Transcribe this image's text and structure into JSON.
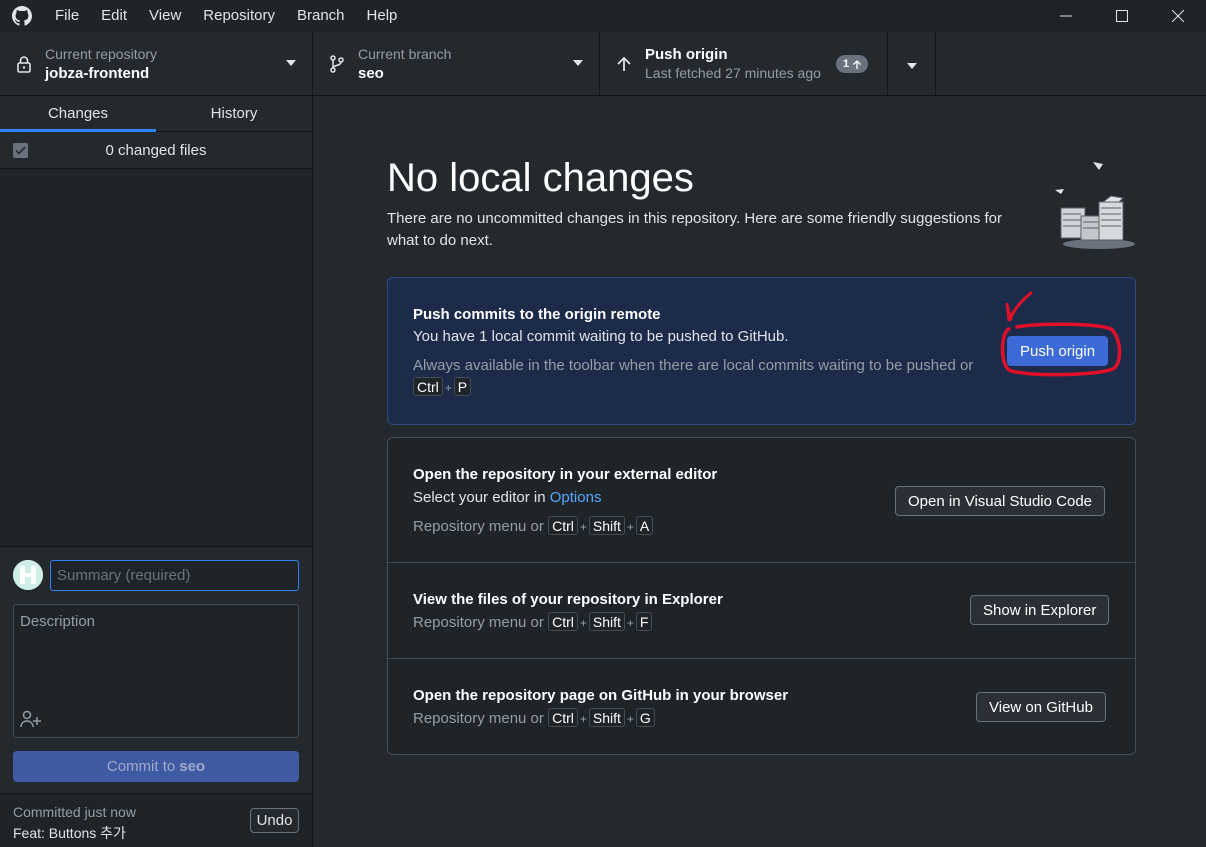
{
  "menubar": {
    "items": [
      "File",
      "Edit",
      "View",
      "Repository",
      "Branch",
      "Help"
    ]
  },
  "toolbar": {
    "repo": {
      "label": "Current repository",
      "value": "jobza-frontend"
    },
    "branch": {
      "label": "Current branch",
      "value": "seo"
    },
    "push": {
      "label": "Push origin",
      "sub": "Last fetched 27 minutes ago",
      "badge": "1"
    }
  },
  "sidebar": {
    "tabs": [
      "Changes",
      "History"
    ],
    "changes_count": "0 changed files",
    "commit": {
      "summary_placeholder": "Summary (required)",
      "description_placeholder": "Description",
      "button_prefix": "Commit to",
      "button_branch": "seo"
    },
    "last_commit": {
      "time": "Committed just now",
      "message": "Feat: Buttons 추가",
      "undo_label": "Undo"
    }
  },
  "main": {
    "title": "No local changes",
    "subtitle": "There are no uncommitted changes in this repository. Here are some friendly suggestions for what to do next.",
    "push_card": {
      "title": "Push commits to the origin remote",
      "desc": "You have 1 local commit waiting to be pushed to GitHub.",
      "hint_prefix": "Always available in the toolbar when there are local commits waiting to be pushed or",
      "keys": [
        "Ctrl",
        "P"
      ],
      "button": "Push origin"
    },
    "editor_row": {
      "title": "Open the repository in your external editor",
      "desc_prefix": "Select your editor in",
      "desc_link": "Options",
      "hint_prefix": "Repository menu or",
      "keys": [
        "Ctrl",
        "Shift",
        "A"
      ],
      "button": "Open in Visual Studio Code"
    },
    "explorer_row": {
      "title": "View the files of your repository in Explorer",
      "hint_prefix": "Repository menu or",
      "keys": [
        "Ctrl",
        "Shift",
        "F"
      ],
      "button": "Show in Explorer"
    },
    "github_row": {
      "title": "Open the repository page on GitHub in your browser",
      "hint_prefix": "Repository menu or",
      "keys": [
        "Ctrl",
        "Shift",
        "G"
      ],
      "button": "View on GitHub"
    }
  },
  "colors": {
    "accent": "#2f81f7",
    "primary_button": "#3c6ad6",
    "annotation": "#e0102a"
  }
}
